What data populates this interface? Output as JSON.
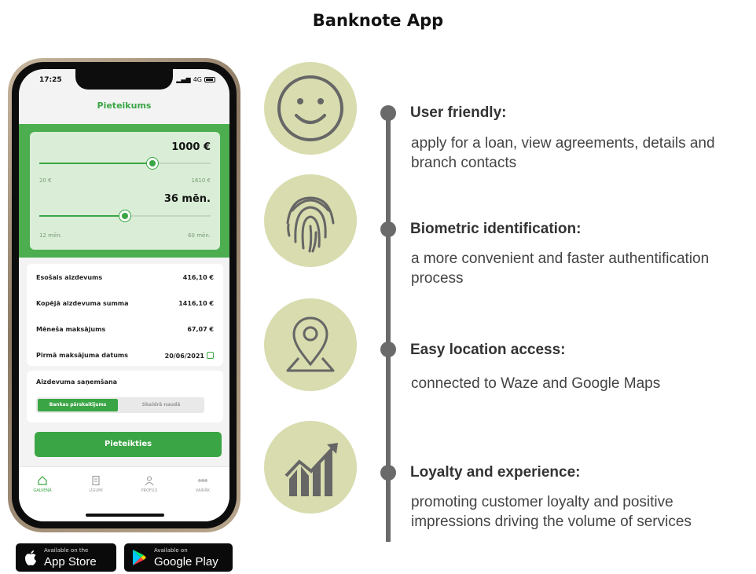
{
  "page": {
    "title": "Banknote App"
  },
  "phone": {
    "status_time": "17:25",
    "status_network": "4G",
    "header_title": "Pieteikums",
    "amount_slider": {
      "value_label": "1000 €",
      "min_label": "20 €",
      "max_label": "1610 €",
      "fill_fraction": 0.66
    },
    "term_slider": {
      "value_label": "36 mēn.",
      "min_label": "12 mēn.",
      "max_label": "60 mēn.",
      "fill_fraction": 0.5
    },
    "info_rows": [
      {
        "label": "Esošais aizdevums",
        "value": "416,10 €"
      },
      {
        "label": "Kopējā aizdevuma summa",
        "value": "1416,10 €"
      },
      {
        "label": "Mēneša maksājums",
        "value": "67,07 €"
      },
      {
        "label": "Pirmā maksājuma datums",
        "value": "20/06/2021"
      }
    ],
    "receive": {
      "title": "Aizdevuma saņemšana",
      "option_selected": "Bankas pārskaitījums",
      "option_other": "Skaidrā naudā"
    },
    "submit_label": "Pieteikties",
    "tabs": [
      {
        "label": "GALVENĀ",
        "icon": "home-icon"
      },
      {
        "label": "LĪGUMI",
        "icon": "document-icon"
      },
      {
        "label": "PROFILS",
        "icon": "user-icon"
      },
      {
        "label": "VAIRĀK",
        "icon": "more-icon"
      }
    ]
  },
  "badges": {
    "app_store": {
      "small": "Available on the",
      "big": "App Store"
    },
    "google_play": {
      "small": "Available on",
      "big": "Google Play"
    }
  },
  "features": [
    {
      "icon": "smiley-icon",
      "title": "User friendly:",
      "description": "apply for a loan, view agreements, details and branch contacts"
    },
    {
      "icon": "fingerprint-icon",
      "title": "Biometric identification:",
      "description": "a more convenient and faster authentification process"
    },
    {
      "icon": "location-pin-icon",
      "title": "Easy location access:",
      "description": "connected to Waze and Google Maps"
    },
    {
      "icon": "growth-chart-icon",
      "title": "Loyalty and experience:",
      "description": "promoting customer loyalty and positive impressions driving the volume of services"
    }
  ],
  "colors": {
    "brand_green": "#4cae4f",
    "circle_bg": "#d8dcae",
    "timeline": "#6a6a6a"
  }
}
